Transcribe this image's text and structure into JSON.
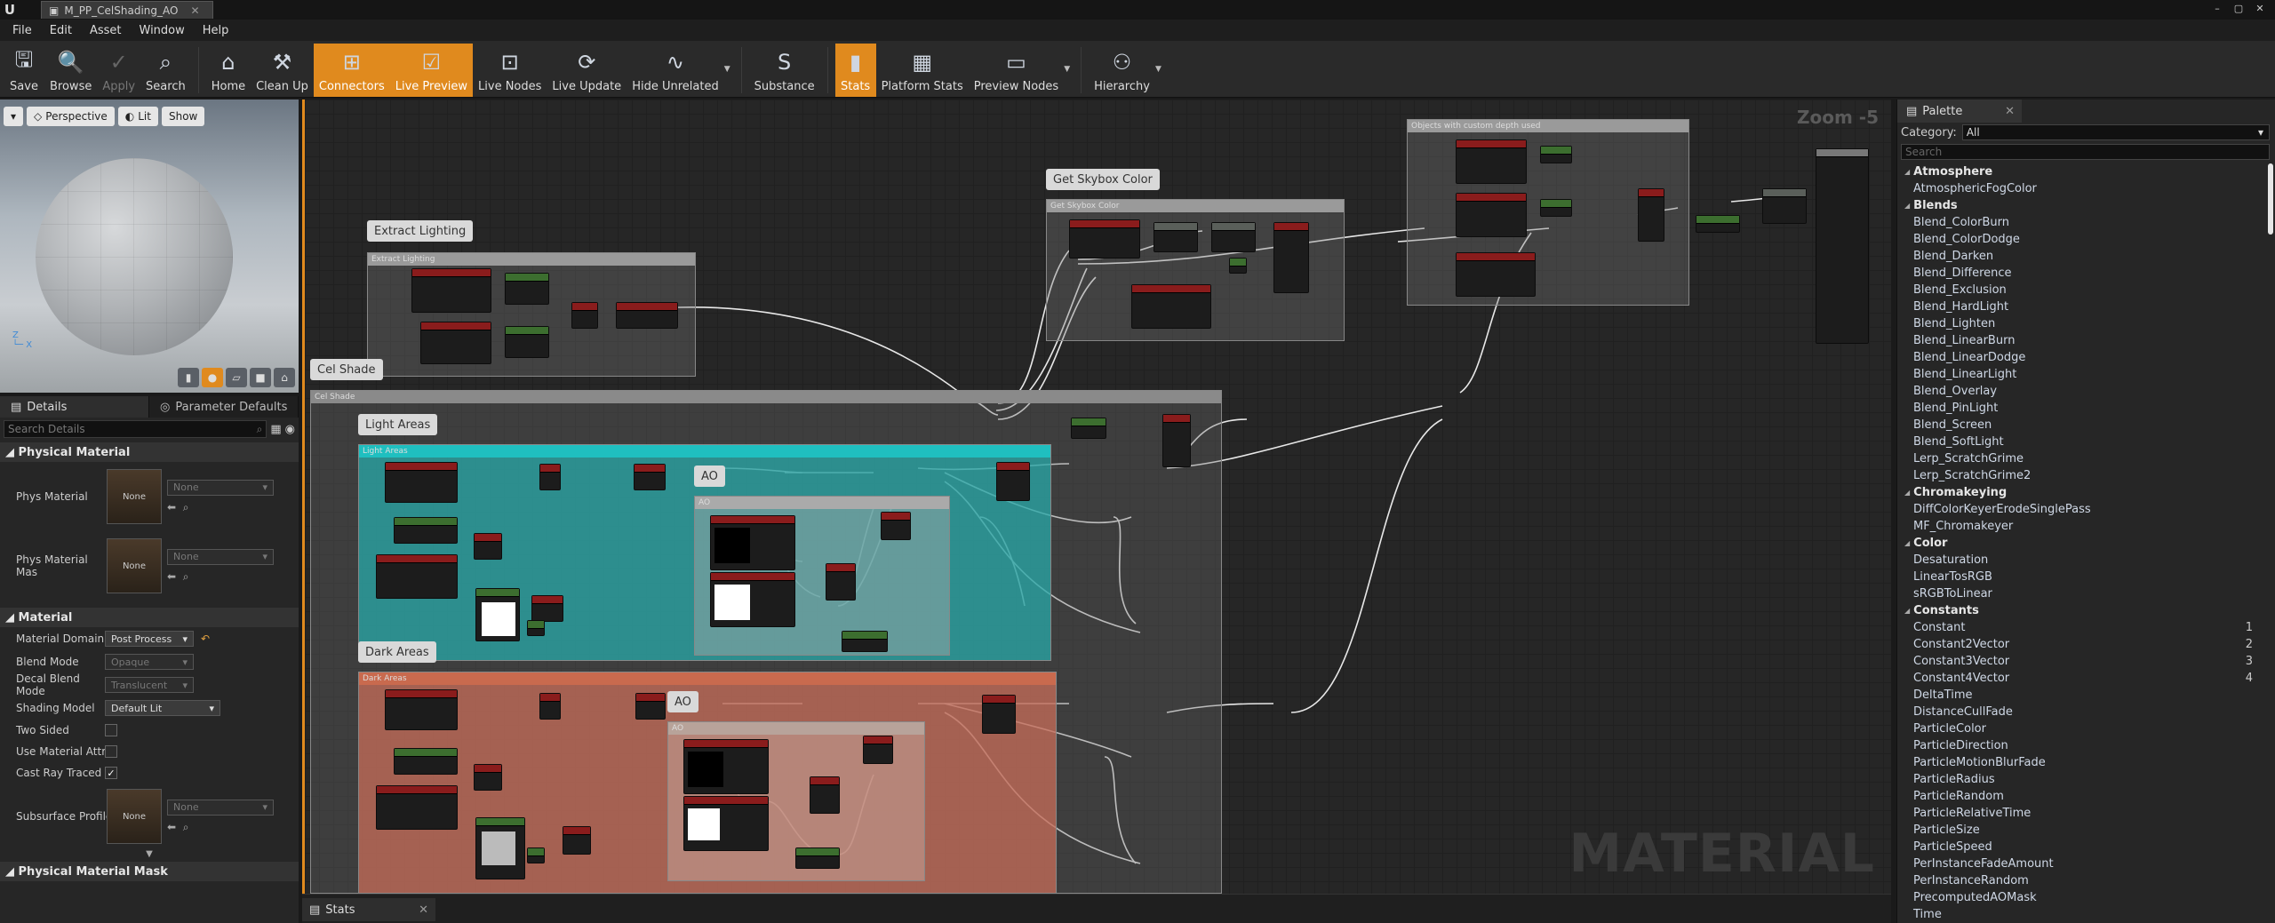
{
  "window": {
    "tab_title": "M_PP_CelShading_AO"
  },
  "menu": [
    "File",
    "Edit",
    "Asset",
    "Window",
    "Help"
  ],
  "toolbar": {
    "save": "Save",
    "browse": "Browse",
    "apply": "Apply",
    "search": "Search",
    "home": "Home",
    "cleanup": "Clean Up",
    "connectors": "Connectors",
    "live_preview": "Live Preview",
    "live_nodes": "Live Nodes",
    "live_update": "Live Update",
    "hide_unrelated": "Hide Unrelated",
    "substance": "Substance",
    "stats": "Stats",
    "platform_stats": "Platform Stats",
    "preview_nodes": "Preview Nodes",
    "hierarchy": "Hierarchy"
  },
  "viewport": {
    "perspective": "Perspective",
    "lit": "Lit",
    "show": "Show"
  },
  "details": {
    "tab_details": "Details",
    "tab_params": "Parameter Defaults",
    "search_placeholder": "Search Details",
    "sec_physical": "Physical Material",
    "phys_material": "Phys Material",
    "phys_material_mask": "Phys Material Mas",
    "none": "None",
    "sec_material": "Material",
    "material_domain": "Material Domain",
    "material_domain_val": "Post Process",
    "blend_mode": "Blend Mode",
    "blend_mode_val": "Opaque",
    "decal_blend_mode": "Decal Blend Mode",
    "decal_blend_mode_val": "Translucent",
    "shading_model": "Shading Model",
    "shading_model_val": "Default Lit",
    "two_sided": "Two Sided",
    "use_material_attrib": "Use Material Attrib",
    "cast_ray_traced": "Cast Ray Traced S",
    "subsurface_profile": "Subsurface Profile",
    "sec_phys_mask": "Physical Material Mask"
  },
  "graph": {
    "zoom": "Zoom -5",
    "watermark": "MATERIAL",
    "bubbles": {
      "extract_lighting": "Extract Lighting",
      "skybox": "Get Skybox Color",
      "cel_shade": "Cel Shade",
      "light_areas": "Light Areas",
      "dark_areas": "Dark Areas",
      "ao": "AO"
    },
    "boxes": {
      "extract_lighting": "Extract Lighting",
      "skybox": "Get Skybox Color",
      "custom_depth": "Objects with custom depth used",
      "cel_shade": "Cel Shade",
      "light_areas": "Light Areas",
      "dark_areas": "Dark Areas",
      "ao": "AO"
    }
  },
  "stats_tab": "Stats",
  "palette": {
    "tab": "Palette",
    "category_label": "Category:",
    "category_value": "All",
    "search_placeholder": "Search",
    "groups": [
      {
        "name": "Atmosphere",
        "items": [
          {
            "label": "AtmosphericFogColor",
            "key": ""
          }
        ]
      },
      {
        "name": "Blends",
        "items": [
          {
            "label": "Blend_ColorBurn",
            "key": ""
          },
          {
            "label": "Blend_ColorDodge",
            "key": ""
          },
          {
            "label": "Blend_Darken",
            "key": ""
          },
          {
            "label": "Blend_Difference",
            "key": ""
          },
          {
            "label": "Blend_Exclusion",
            "key": ""
          },
          {
            "label": "Blend_HardLight",
            "key": ""
          },
          {
            "label": "Blend_Lighten",
            "key": ""
          },
          {
            "label": "Blend_LinearBurn",
            "key": ""
          },
          {
            "label": "Blend_LinearDodge",
            "key": ""
          },
          {
            "label": "Blend_LinearLight",
            "key": ""
          },
          {
            "label": "Blend_Overlay",
            "key": ""
          },
          {
            "label": "Blend_PinLight",
            "key": ""
          },
          {
            "label": "Blend_Screen",
            "key": ""
          },
          {
            "label": "Blend_SoftLight",
            "key": ""
          },
          {
            "label": "Lerp_ScratchGrime",
            "key": ""
          },
          {
            "label": "Lerp_ScratchGrime2",
            "key": ""
          }
        ]
      },
      {
        "name": "Chromakeying",
        "items": [
          {
            "label": "DiffColorKeyerErodeSinglePass",
            "key": ""
          },
          {
            "label": "MF_Chromakeyer",
            "key": ""
          }
        ]
      },
      {
        "name": "Color",
        "items": [
          {
            "label": "Desaturation",
            "key": ""
          },
          {
            "label": "LinearTosRGB",
            "key": ""
          },
          {
            "label": "sRGBToLinear",
            "key": ""
          }
        ]
      },
      {
        "name": "Constants",
        "items": [
          {
            "label": "Constant",
            "key": "1"
          },
          {
            "label": "Constant2Vector",
            "key": "2"
          },
          {
            "label": "Constant3Vector",
            "key": "3"
          },
          {
            "label": "Constant4Vector",
            "key": "4"
          },
          {
            "label": "DeltaTime",
            "key": ""
          },
          {
            "label": "DistanceCullFade",
            "key": ""
          },
          {
            "label": "ParticleColor",
            "key": ""
          },
          {
            "label": "ParticleDirection",
            "key": ""
          },
          {
            "label": "ParticleMotionBlurFade",
            "key": ""
          },
          {
            "label": "ParticleRadius",
            "key": ""
          },
          {
            "label": "ParticleRandom",
            "key": ""
          },
          {
            "label": "ParticleRelativeTime",
            "key": ""
          },
          {
            "label": "ParticleSize",
            "key": ""
          },
          {
            "label": "ParticleSpeed",
            "key": ""
          },
          {
            "label": "PerInstanceFadeAmount",
            "key": ""
          },
          {
            "label": "PerInstanceRandom",
            "key": ""
          },
          {
            "label": "PrecomputedAOMask",
            "key": ""
          },
          {
            "label": "Time",
            "key": ""
          }
        ]
      }
    ]
  }
}
